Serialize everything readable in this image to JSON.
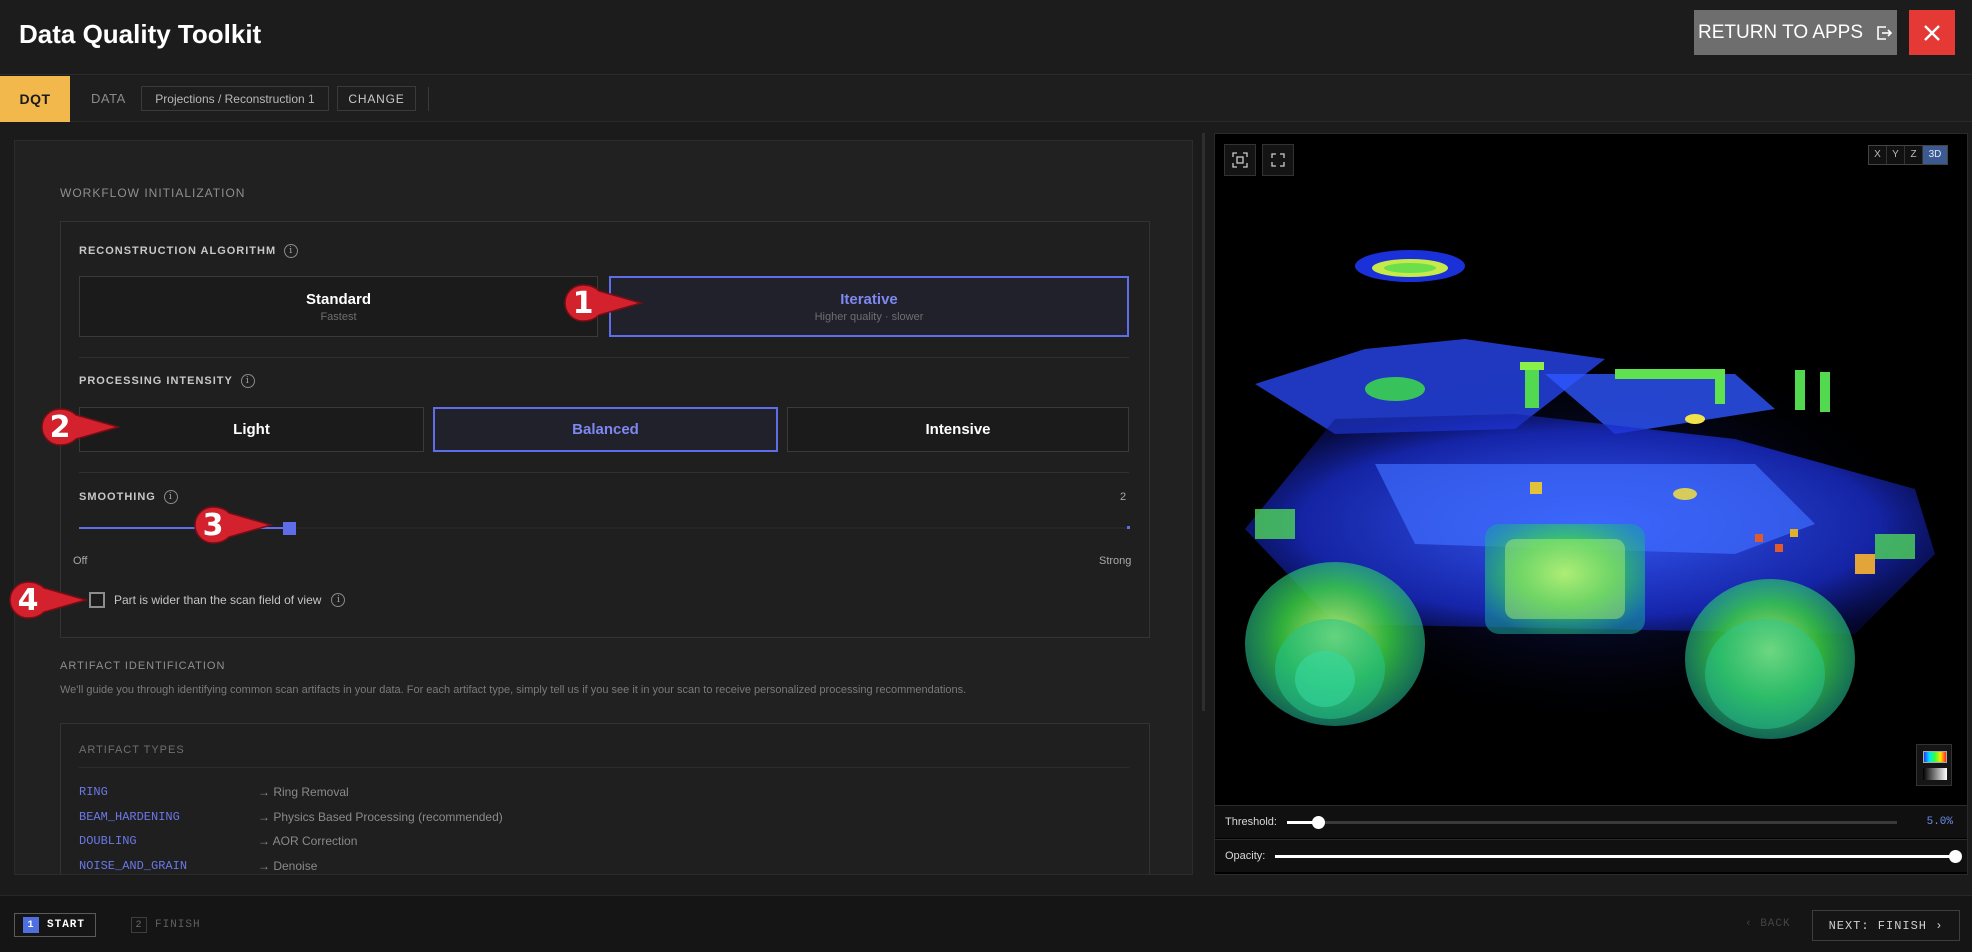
{
  "header": {
    "title": "Data Quality Toolkit",
    "return_label": "RETURN TO APPS",
    "close_icon": "close-icon",
    "close_color": "#e53935"
  },
  "breadcrumb": {
    "dqt_label": "DQT",
    "data_label": "DATA",
    "path": "Projections / Reconstruction 1",
    "change_label": "CHANGE",
    "accent": "#f2b84b"
  },
  "workflow": {
    "section_title": "WORKFLOW INITIALIZATION",
    "algorithm": {
      "label": "RECONSTRUCTION ALGORITHM",
      "options": [
        {
          "title": "Standard",
          "subtitle": "Fastest",
          "selected": false
        },
        {
          "title": "Iterative",
          "subtitle": "Higher quality · slower",
          "selected": true
        }
      ]
    },
    "intensity": {
      "label": "PROCESSING INTENSITY",
      "options": [
        {
          "title": "Light",
          "selected": false
        },
        {
          "title": "Balanced",
          "selected": true
        },
        {
          "title": "Intensive",
          "selected": false
        }
      ]
    },
    "smoothing": {
      "label": "SMOOTHING",
      "value": "2",
      "min_label": "Off",
      "max_label": "Strong",
      "level_fraction": 0.2
    },
    "wide_part": {
      "label": "Part is wider than the scan field of view",
      "checked": false
    }
  },
  "artifacts": {
    "section_title": "ARTIFACT IDENTIFICATION",
    "description": "We'll guide you through identifying common scan artifacts in your data. For each artifact type, simply tell us if you see it in your scan to receive personalized processing recommendations.",
    "types_title": "ARTIFACT TYPES",
    "rows": [
      {
        "key": "RING",
        "value": "→ Ring Removal"
      },
      {
        "key": "BEAM_HARDENING",
        "value": "→ Physics Based Processing (recommended)"
      },
      {
        "key": "DOUBLING",
        "value": "→ AOR Correction"
      },
      {
        "key": "NOISE_AND_GRAIN",
        "value": "→ Denoise"
      }
    ]
  },
  "markers": [
    "1",
    "2",
    "3",
    "4"
  ],
  "viewer": {
    "axes": [
      "X",
      "Y",
      "Z",
      "3D"
    ],
    "active_axis": "3D",
    "threshold_label": "Threshold:",
    "threshold_value": "5.0%",
    "threshold_fraction": 0.05,
    "opacity_label": "Opacity:",
    "opacity_fraction": 1.0,
    "colormaps": [
      "rainbow",
      "grayscale"
    ]
  },
  "footer": {
    "steps": [
      {
        "num": "1",
        "label": "START",
        "active": true
      },
      {
        "num": "2",
        "label": "FINISH",
        "active": false
      }
    ],
    "back_label": "‹ BACK",
    "next_label": "NEXT: FINISH ›"
  },
  "colors": {
    "selection": "#5f6ee8",
    "marker": "#d3212d"
  }
}
